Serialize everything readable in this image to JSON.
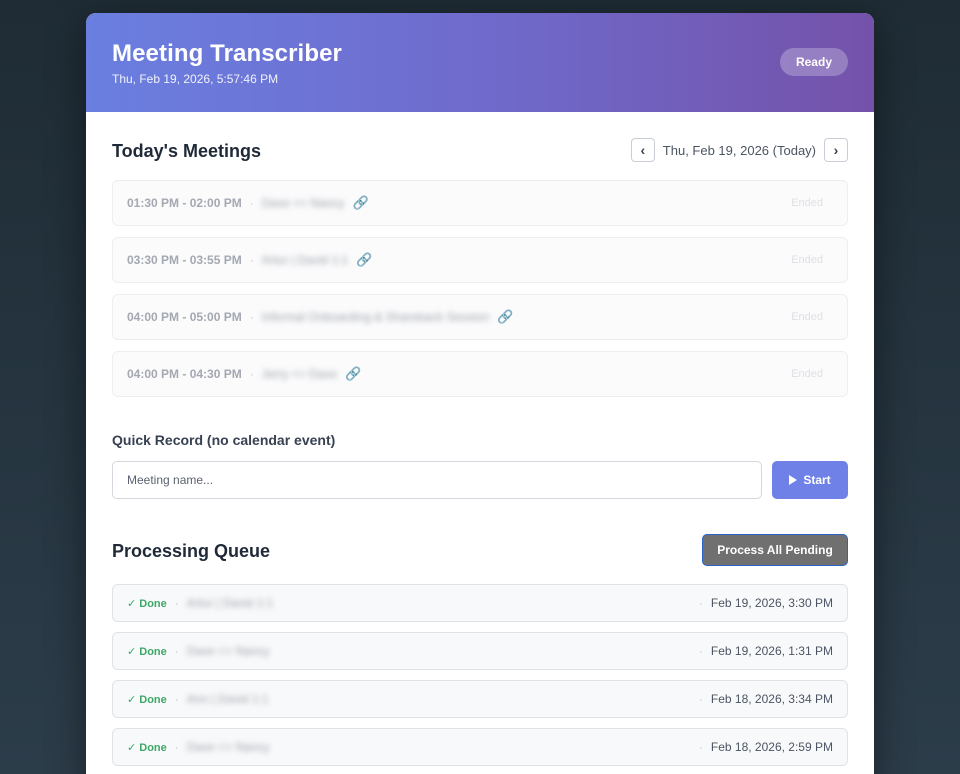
{
  "header": {
    "title": "Meeting Transcriber",
    "datetime": "Thu, Feb 19, 2026, 5:57:46 PM",
    "status": "Ready"
  },
  "meetings": {
    "title": "Today's Meetings",
    "nav": {
      "prev": "‹",
      "next": "›",
      "date": "Thu, Feb 19, 2026 (Today)"
    },
    "items": [
      {
        "time": "01:30 PM - 02:00 PM",
        "name": "Dave <> Nancy",
        "status": "Ended"
      },
      {
        "time": "03:30 PM - 03:55 PM",
        "name": "Artur | David 1:1",
        "status": "Ended"
      },
      {
        "time": "04:00 PM - 05:00 PM",
        "name": "Informal Onboarding & Shareback Session",
        "status": "Ended"
      },
      {
        "time": "04:00 PM - 04:30 PM",
        "name": "Jerry <> Dave",
        "status": "Ended"
      }
    ],
    "separator": "·",
    "link_icon": "🔗"
  },
  "quick_record": {
    "title": "Quick Record (no calendar event)",
    "placeholder": "Meeting name...",
    "start_label": "Start"
  },
  "queue": {
    "title": "Processing Queue",
    "process_all_label": "Process All Pending",
    "separator": "·",
    "items": [
      {
        "status": "✓ Done",
        "name": "Artur | David 1:1",
        "date": "Feb 19, 2026, 3:30 PM"
      },
      {
        "status": "✓ Done",
        "name": "Dave <> Nancy",
        "date": "Feb 19, 2026, 1:31 PM"
      },
      {
        "status": "✓ Done",
        "name": "Ann | David 1:1",
        "date": "Feb 18, 2026, 3:34 PM"
      },
      {
        "status": "✓ Done",
        "name": "Dave <> Nancy",
        "date": "Feb 18, 2026, 2:59 PM"
      }
    ]
  },
  "colors": {
    "header_start": "#6a7fe0",
    "header_end": "#7452aa",
    "accent": "#6f80e6",
    "done": "#3fa866"
  }
}
